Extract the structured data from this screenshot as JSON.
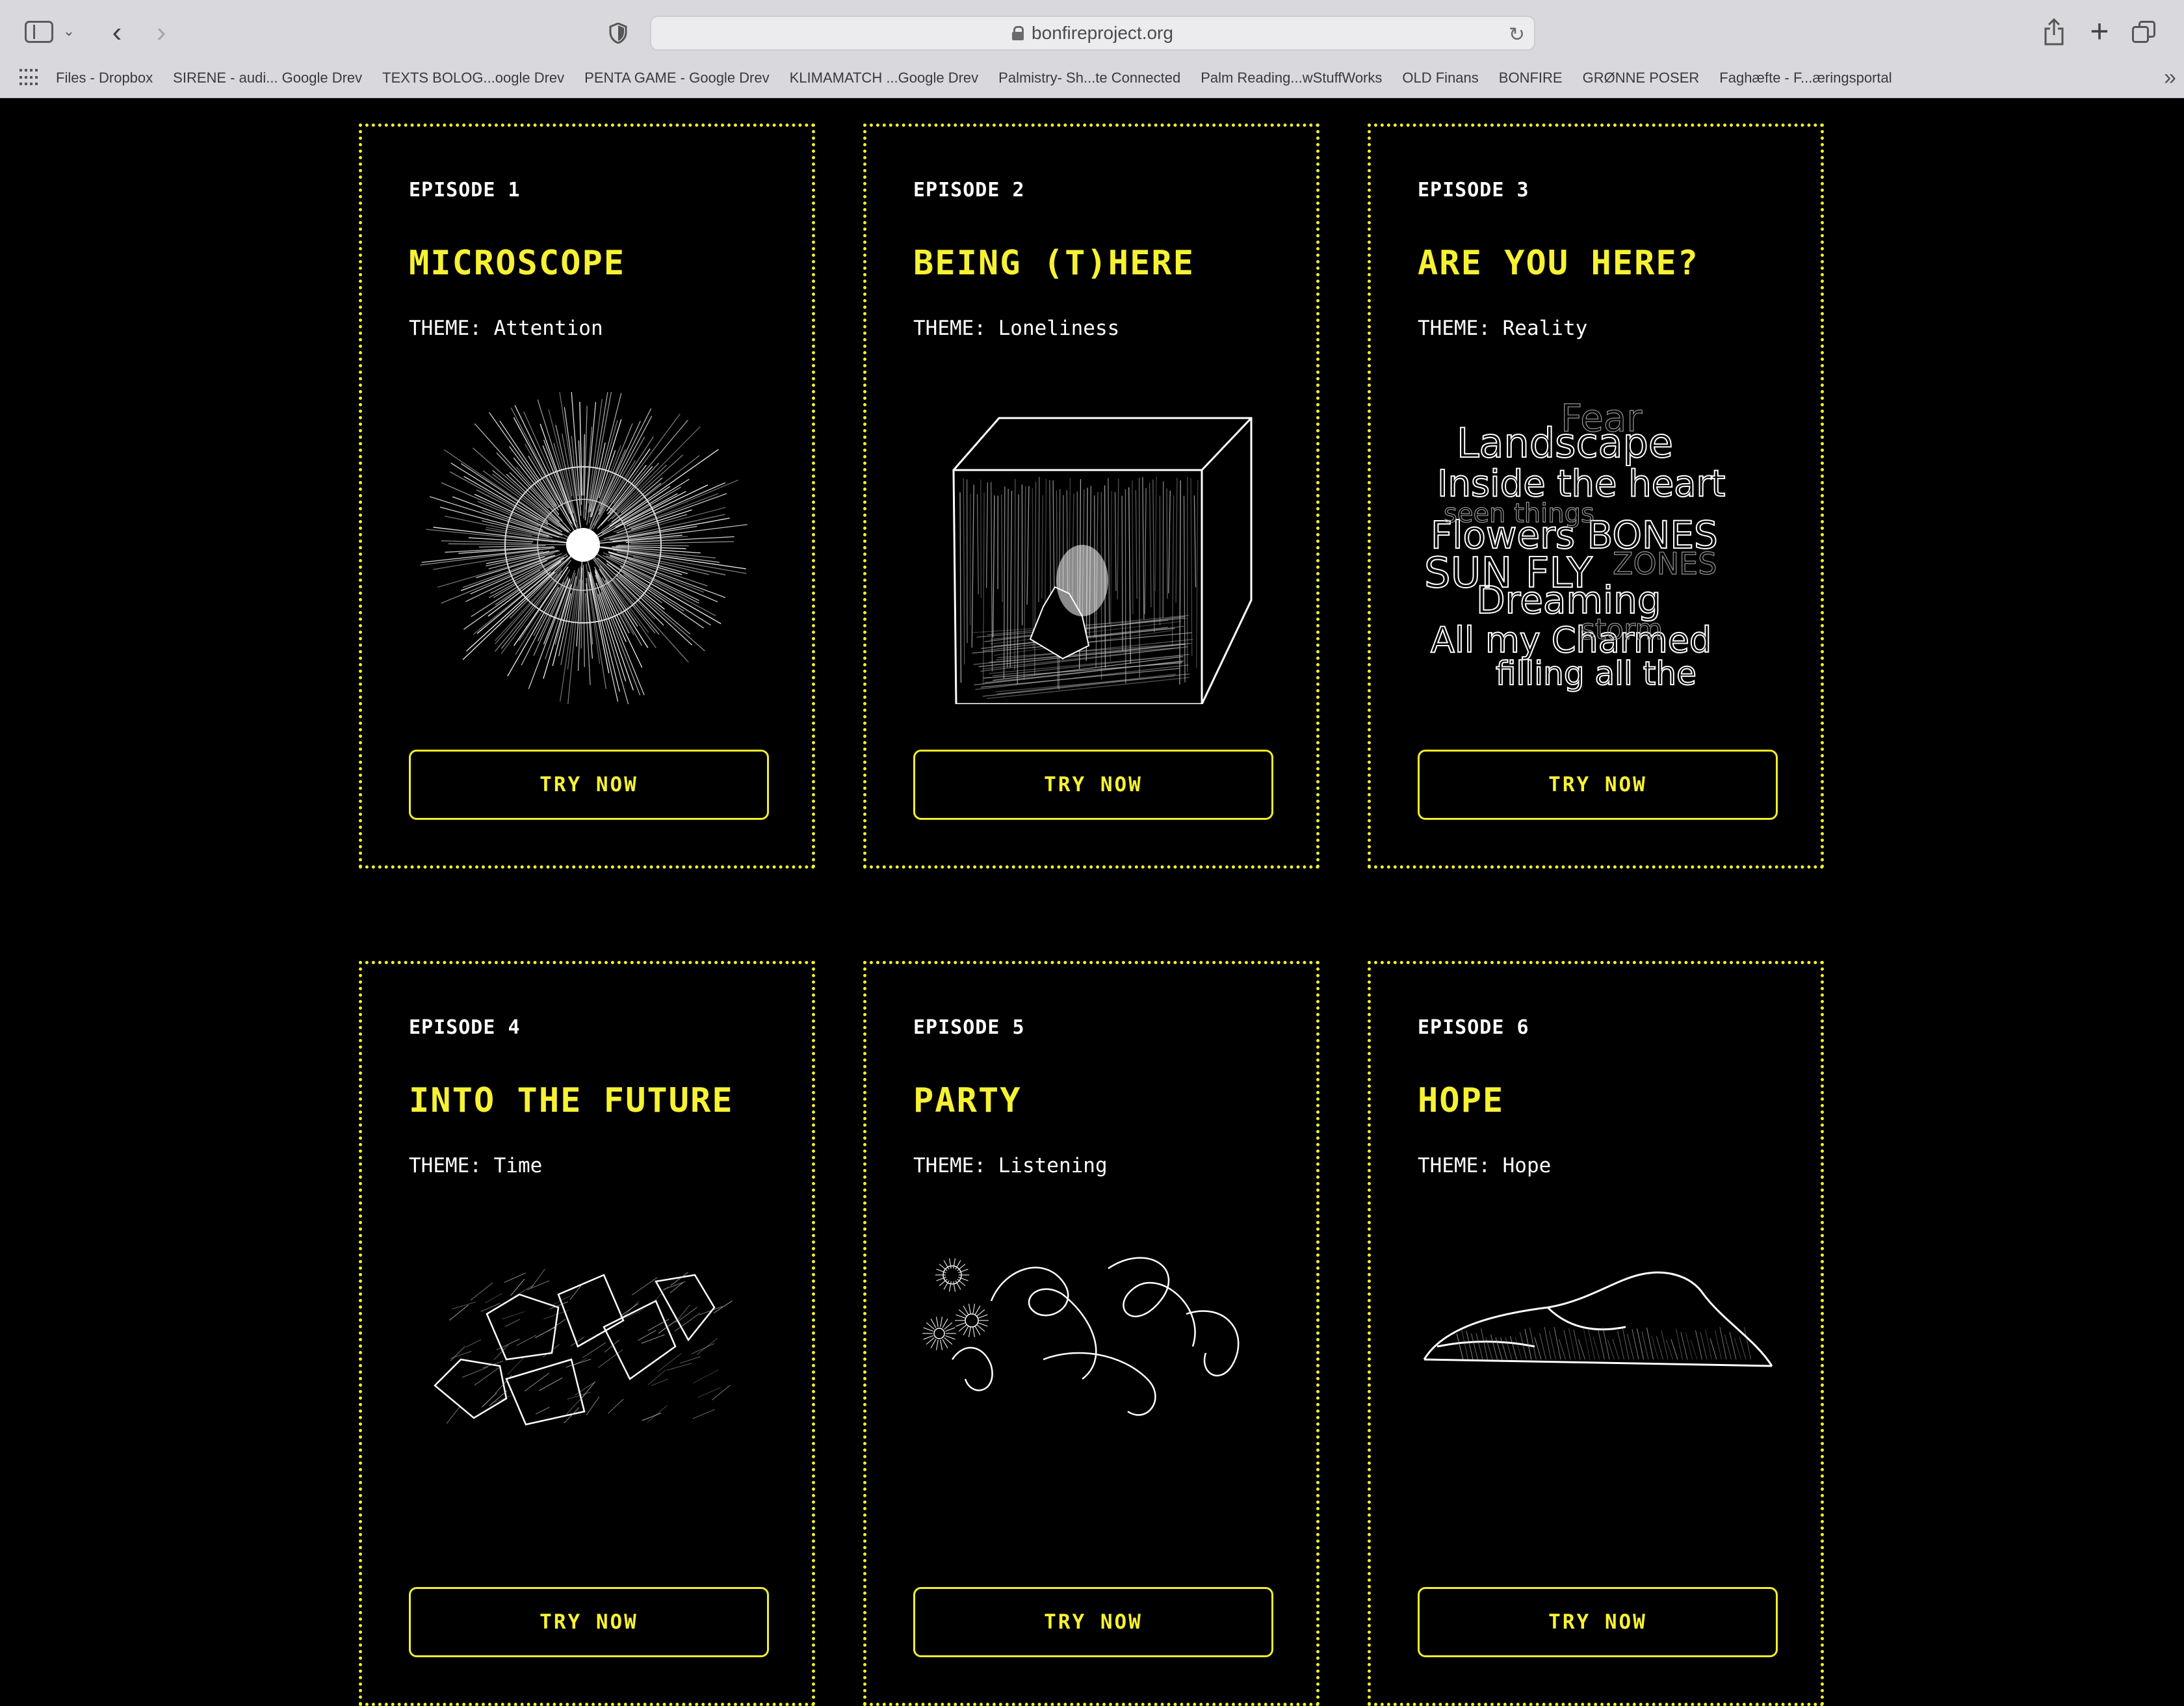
{
  "browser": {
    "url": "bonfireproject.org",
    "bookmarks": [
      "Files - Dropbox",
      "SIRENE - audi... Google Drev",
      "TEXTS BOLOG...oogle Drev",
      "PENTA GAME - Google Drev",
      "KLIMAMATCH ...Google Drev",
      "Palmistry- Sh...te Connected",
      "Palm Reading...wStuffWorks",
      "OLD Finans",
      "BONFIRE",
      "GRØNNE POSER",
      "Faghæfte - F...æringsportal"
    ]
  },
  "episodes": [
    {
      "episode": "EPISODE 1",
      "title": "MICROSCOPE",
      "theme": "THEME: Attention",
      "button": "TRY NOW",
      "art": "sunburst-drawing"
    },
    {
      "episode": "EPISODE 2",
      "title": "BEING (T)HERE",
      "theme": "THEME: Loneliness",
      "button": "TRY NOW",
      "art": "cube-room-drawing"
    },
    {
      "episode": "EPISODE 3",
      "title": "ARE YOU HERE?",
      "theme": "THEME: Reality",
      "button": "TRY NOW",
      "art": "scribbled-words-drawing"
    },
    {
      "episode": "EPISODE 4",
      "title": "INTO THE FUTURE",
      "theme": "THEME: Time",
      "button": "TRY NOW",
      "art": "crystal-blocks-drawing"
    },
    {
      "episode": "EPISODE 5",
      "title": "PARTY",
      "theme": "THEME: Listening",
      "button": "TRY NOW",
      "art": "party-tendrils-drawing"
    },
    {
      "episode": "EPISODE 6",
      "title": "HOPE",
      "theme": "THEME: Hope",
      "button": "TRY NOW",
      "art": "sneaker-drawing"
    }
  ],
  "colors": {
    "accent": "#f6f233",
    "background": "#000000",
    "text": "#ffffff"
  }
}
